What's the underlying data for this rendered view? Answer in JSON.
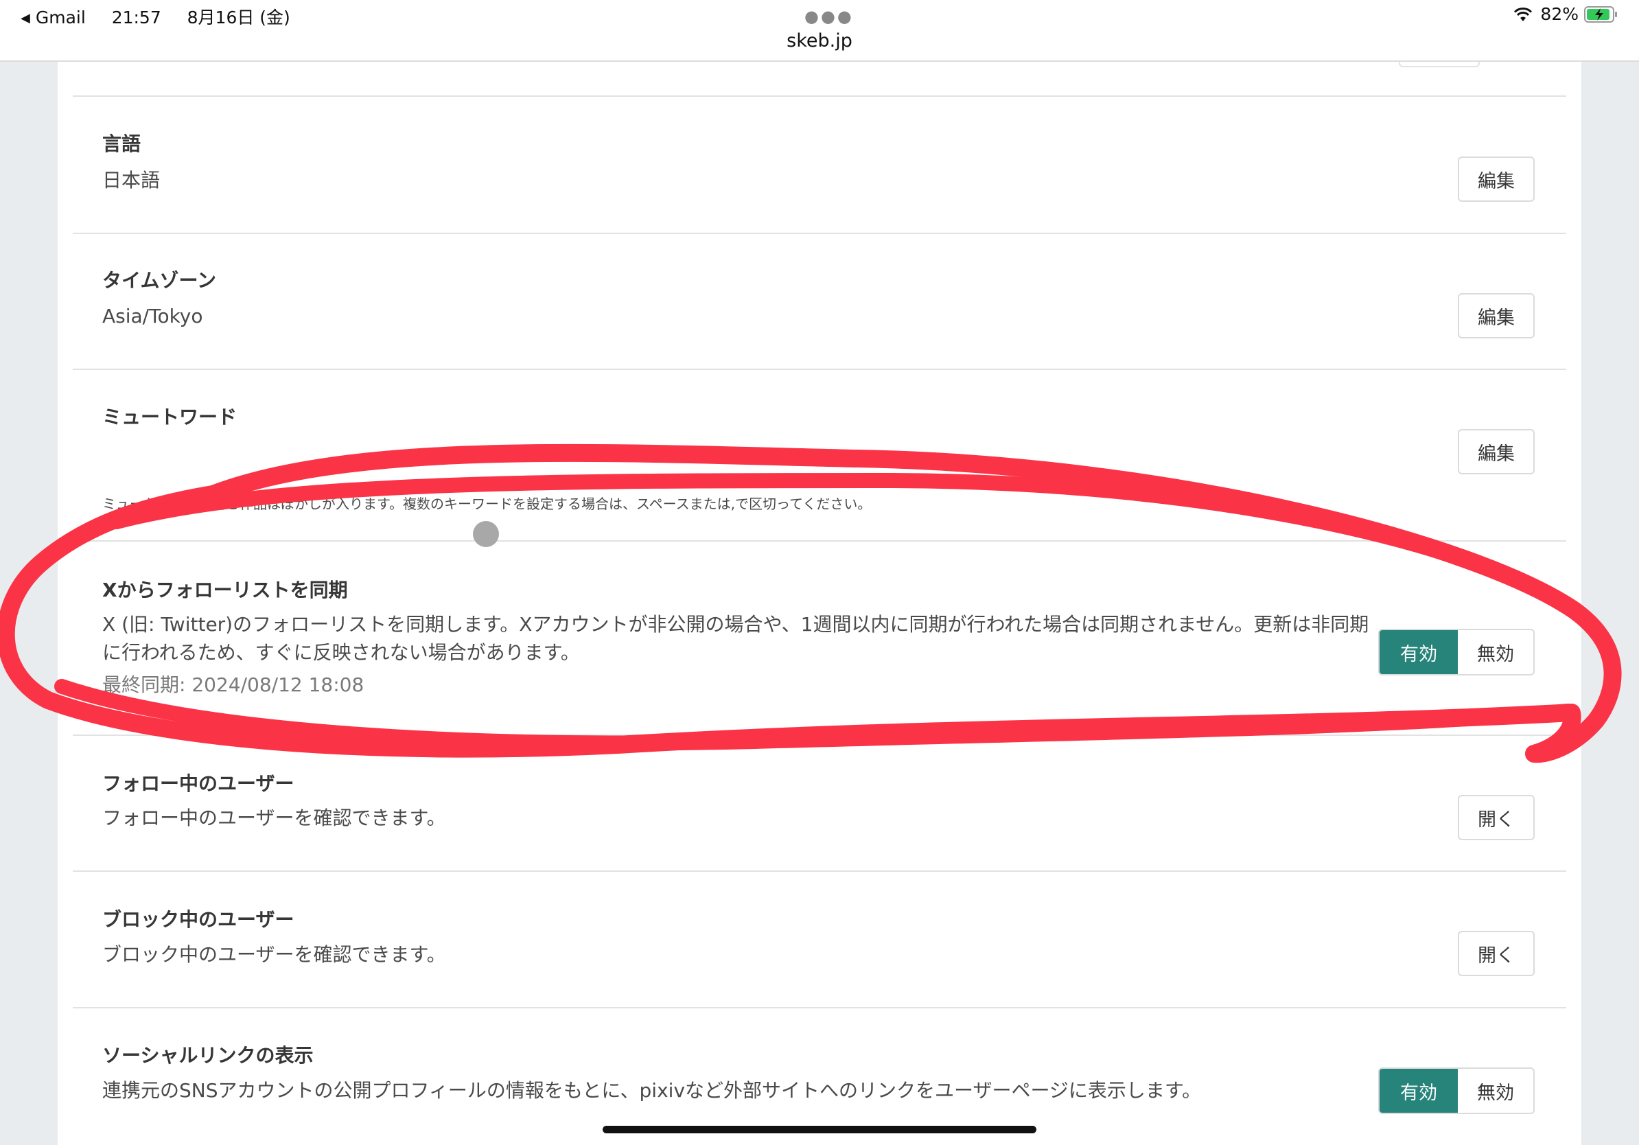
{
  "status_bar": {
    "back_app": "Gmail",
    "time": "21:57",
    "date": "8月16日 (金)",
    "url": "skeb.jp",
    "battery": "82%"
  },
  "settings": {
    "language": {
      "title": "言語",
      "value": "日本語",
      "button": "編集"
    },
    "timezone": {
      "title": "タイムゾーン",
      "value": "Asia/Tokyo",
      "button": "編集"
    },
    "mute_words": {
      "title": "ミュートワード",
      "button": "編集",
      "help": "ミュートワードを含む作品はぼかしが入ります。複数のキーワードを設定する場合は、スペースまたは,で区切ってください。"
    },
    "x_sync": {
      "title": "Xからフォローリストを同期",
      "desc_line1": "X (旧: Twitter)のフォローリストを同期します。Xアカウントが非公開の場合や、1週間以内に同期が行われた場合は同期されません。更新は非同期",
      "desc_line2": "に行われるため、すぐに反映されない場合があります。",
      "last_sync": "最終同期: 2024/08/12 18:08",
      "on_label": "有効",
      "off_label": "無効",
      "state": "有効"
    },
    "following": {
      "title": "フォロー中のユーザー",
      "desc": "フォロー中のユーザーを確認できます。",
      "button": "開く"
    },
    "blocked": {
      "title": "ブロック中のユーザー",
      "desc": "ブロック中のユーザーを確認できます。",
      "button": "開く"
    },
    "social_links": {
      "title": "ソーシャルリンクの表示",
      "desc": "連携元のSNSアカウントの公開プロフィールの情報をもとに、pixivなど外部サイトへのリンクをユーザーページに表示します。",
      "on_label": "有効",
      "off_label": "無効",
      "state": "有効"
    }
  },
  "colors": {
    "accent": "#26847b",
    "annotation": "#fa3346",
    "background": "#e8ecef"
  }
}
